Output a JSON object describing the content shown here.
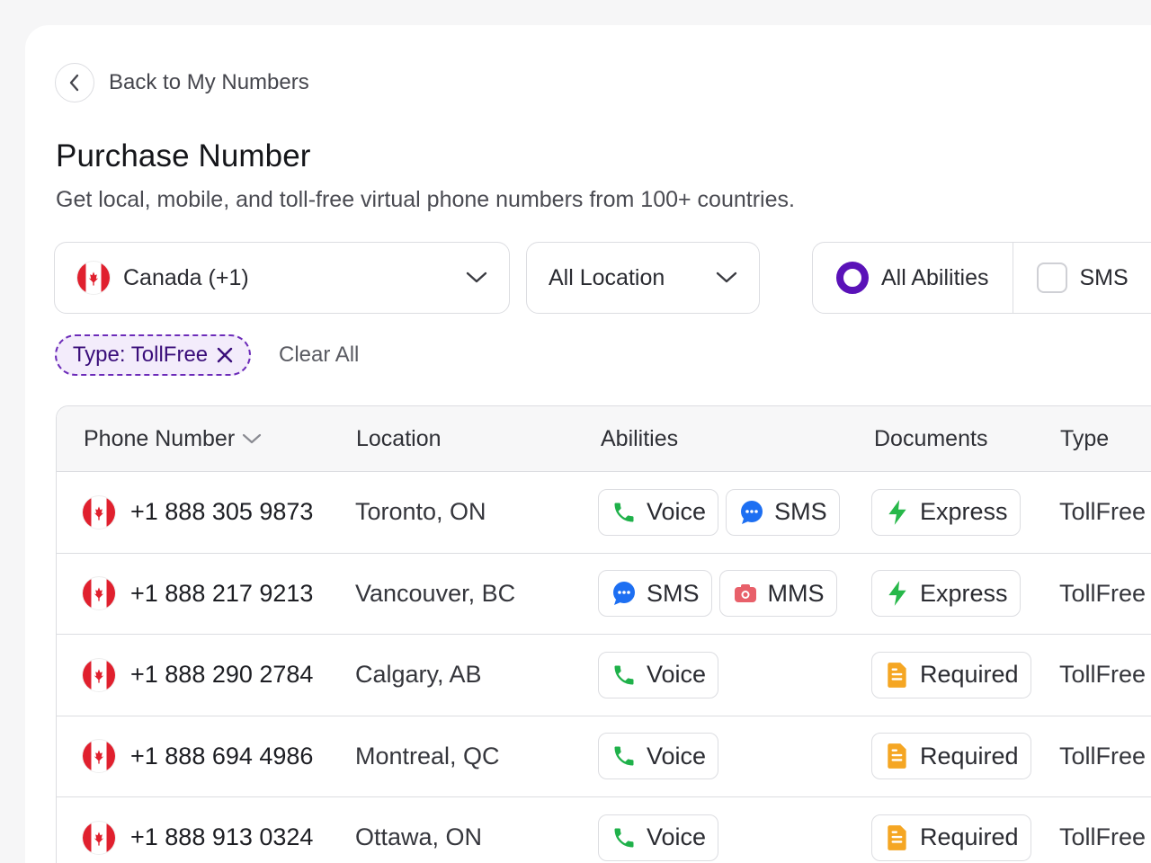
{
  "back": {
    "label": "Back to My Numbers"
  },
  "header": {
    "title": "Purchase Number",
    "subtitle": "Get local, mobile, and toll-free virtual phone numbers from 100+ countries."
  },
  "filters": {
    "country": "Canada (+1)",
    "location": "All Location",
    "abilities": [
      {
        "label": "All Abilities",
        "selected": true
      },
      {
        "label": "SMS",
        "selected": false
      }
    ],
    "active_chip": "Type: TollFree",
    "clear_all": "Clear All"
  },
  "table": {
    "columns": [
      "Phone Number",
      "Location",
      "Abilities",
      "Documents",
      "Type"
    ],
    "rows": [
      {
        "phone": "+1 888 305 9873",
        "location": "Toronto, ON",
        "abilities": [
          {
            "label": "Voice",
            "icon": "phone-icon"
          },
          {
            "label": "SMS",
            "icon": "chat-bubble-icon"
          }
        ],
        "document": {
          "label": "Express",
          "icon": "lightning-icon"
        },
        "type": "TollFree"
      },
      {
        "phone": "+1 888 217 9213",
        "location": "Vancouver, BC",
        "abilities": [
          {
            "label": "SMS",
            "icon": "chat-bubble-icon"
          },
          {
            "label": "MMS",
            "icon": "camera-icon"
          }
        ],
        "document": {
          "label": "Express",
          "icon": "lightning-icon"
        },
        "type": "TollFree"
      },
      {
        "phone": "+1 888 290 2784",
        "location": "Calgary, AB",
        "abilities": [
          {
            "label": "Voice",
            "icon": "phone-icon"
          }
        ],
        "document": {
          "label": "Required",
          "icon": "document-icon"
        },
        "type": "TollFree"
      },
      {
        "phone": "+1 888 694 4986",
        "location": "Montreal, QC",
        "abilities": [
          {
            "label": "Voice",
            "icon": "phone-icon"
          }
        ],
        "document": {
          "label": "Required",
          "icon": "document-icon"
        },
        "type": "TollFree"
      },
      {
        "phone": "+1 888 913 0324",
        "location": "Ottawa, ON",
        "abilities": [
          {
            "label": "Voice",
            "icon": "phone-icon"
          }
        ],
        "document": {
          "label": "Required",
          "icon": "document-icon"
        },
        "type": "TollFree"
      }
    ]
  },
  "colors": {
    "accent": "#5a12b8",
    "voice_green": "#1fb14a",
    "sms_blue": "#1d6ff2",
    "mms_red": "#e8606a",
    "express_green": "#27b84a",
    "required_orange": "#f5a623",
    "flag_red": "#e0202e"
  }
}
